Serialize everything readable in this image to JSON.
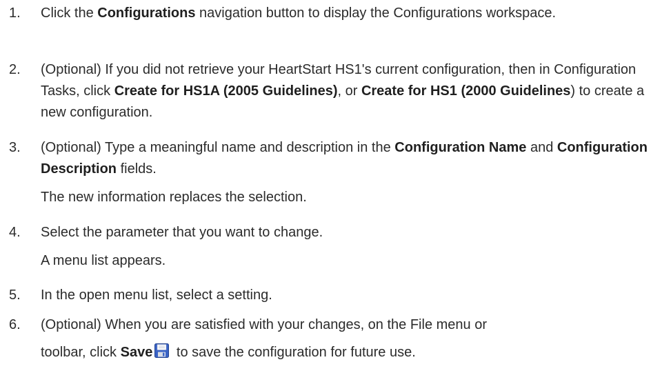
{
  "steps": [
    {
      "number": "1.",
      "parts": [
        "Click the ",
        "Configurations",
        " navigation button to display the Configurations workspace."
      ]
    },
    {
      "number": "2.",
      "parts": [
        "(Optional) If you did not retrieve your HeartStart HS1's current configuration, then in Configuration Tasks, click ",
        "Create for HS1A (2005 Guidelines)",
        ", or ",
        "Create for HS1 (2000 Guidelines",
        ") to create a new configuration."
      ]
    },
    {
      "number": "3.",
      "parts": [
        "(Optional) Type a meaningful name and description in the ",
        "Configuration Name",
        " and ",
        "Configuration Description",
        " fields."
      ],
      "note": "The new information replaces the selection."
    },
    {
      "number": "4.",
      "parts": [
        "Select the parameter that you want to change."
      ],
      "note": "A menu list appears."
    },
    {
      "number": "5.",
      "parts": [
        "In the open menu list, select a setting."
      ]
    },
    {
      "number": "6.",
      "line1": "(Optional) When you are satisfied with your changes, on the File menu or",
      "line2_before": "toolbar, click ",
      "line2_bold": "Save",
      "line2_after": " to save the configuration for future use."
    }
  ],
  "icons": {
    "save": "save-floppy-icon"
  },
  "colors": {
    "text": "#2b2b2b",
    "icon_blue": "#3a63c6"
  }
}
